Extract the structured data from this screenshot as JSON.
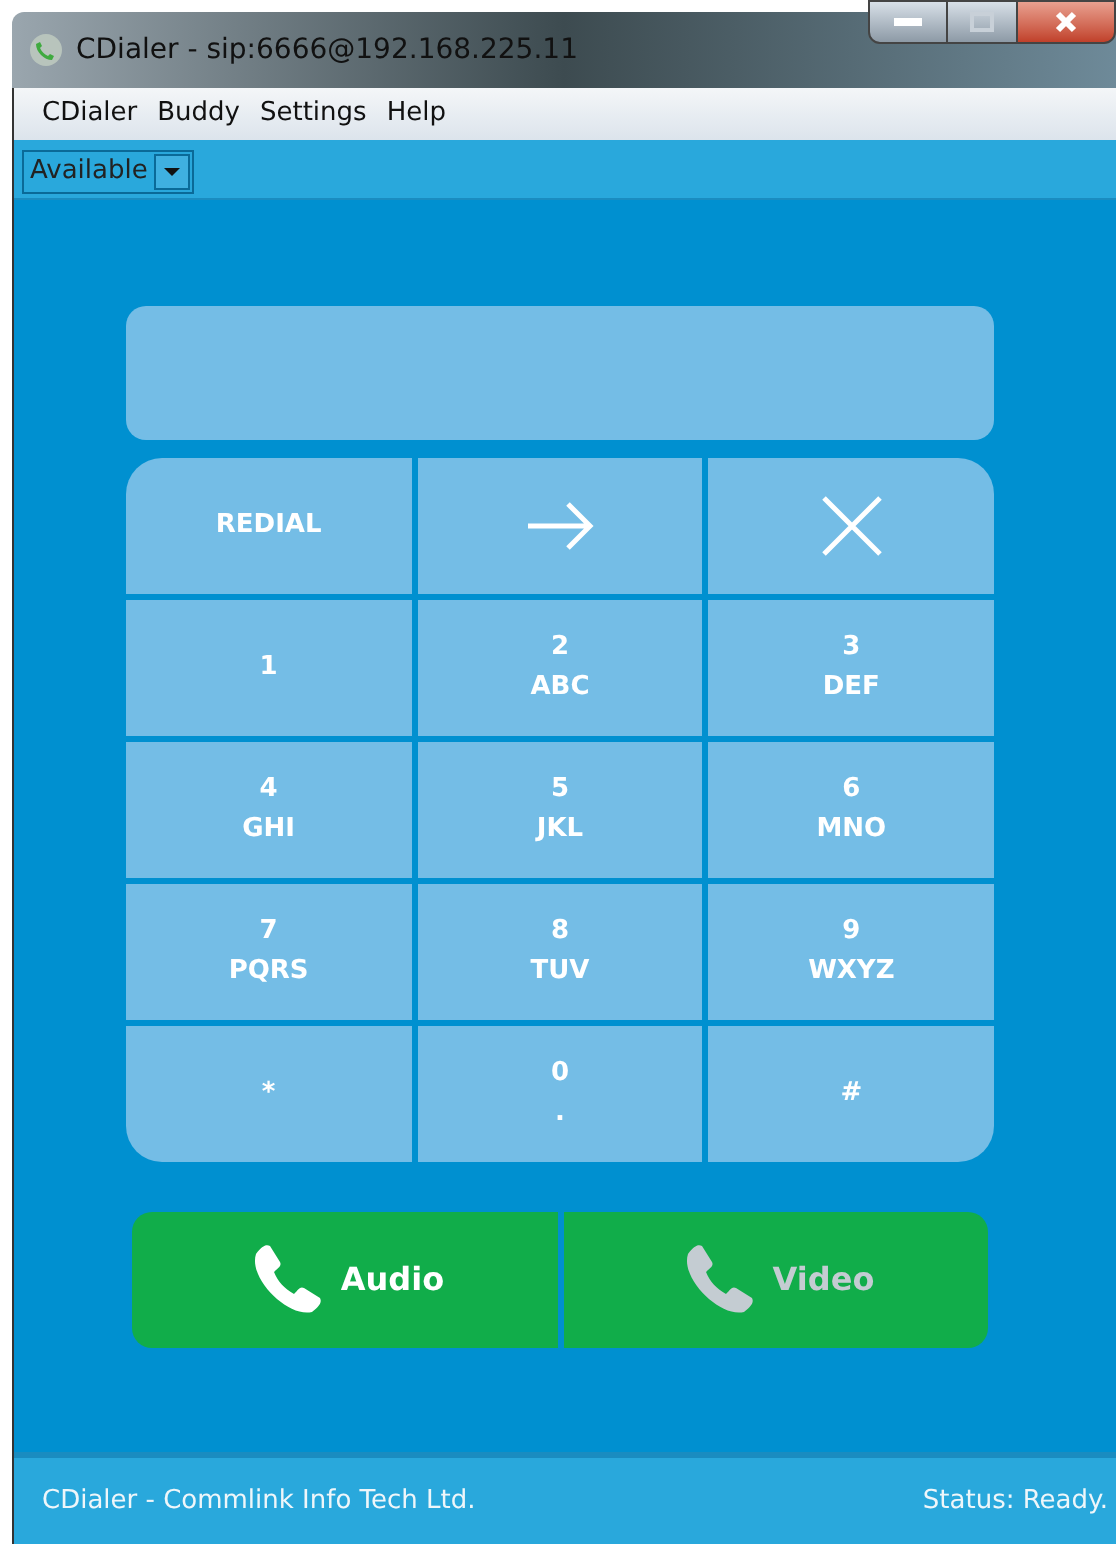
{
  "window": {
    "title": "CDialer - sip:6666@192.168.225.11"
  },
  "menu": [
    "CDialer",
    "Buddy",
    "Settings",
    "Help"
  ],
  "presence": {
    "value": "Available"
  },
  "keypad": [
    {
      "kind": "text",
      "label": "REDIAL"
    },
    {
      "kind": "forward"
    },
    {
      "kind": "clear"
    },
    {
      "kind": "digit",
      "digit": "1"
    },
    {
      "kind": "digit",
      "digit": "2",
      "letters": "ABC"
    },
    {
      "kind": "digit",
      "digit": "3",
      "letters": "DEF"
    },
    {
      "kind": "digit",
      "digit": "4",
      "letters": "GHI"
    },
    {
      "kind": "digit",
      "digit": "5",
      "letters": "JKL"
    },
    {
      "kind": "digit",
      "digit": "6",
      "letters": "MNO"
    },
    {
      "kind": "digit",
      "digit": "7",
      "letters": "PQRS"
    },
    {
      "kind": "digit",
      "digit": "8",
      "letters": "TUV"
    },
    {
      "kind": "digit",
      "digit": "9",
      "letters": "WXYZ"
    },
    {
      "kind": "digit",
      "digit": "*"
    },
    {
      "kind": "digit",
      "digit": "0",
      "letters": "."
    },
    {
      "kind": "digit",
      "digit": "#"
    }
  ],
  "call_buttons": [
    {
      "label": "Audio",
      "disabled": false
    },
    {
      "label": "Video",
      "disabled": true
    }
  ],
  "status_bar": {
    "left": "CDialer - Commlink Info Tech Ltd.",
    "right": "Status: Ready."
  }
}
